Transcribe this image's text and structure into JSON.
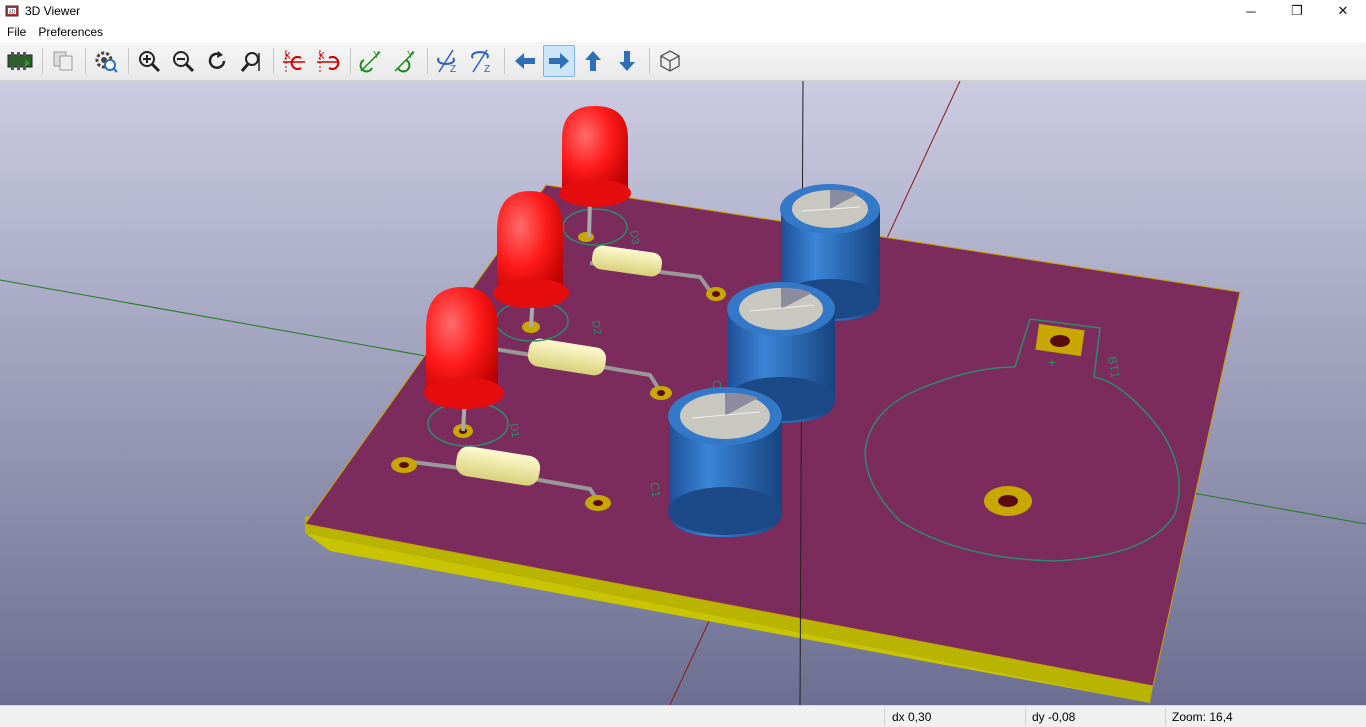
{
  "window": {
    "title": "3D Viewer",
    "controls": {
      "minimize": "─",
      "restore": "❐",
      "close": "✕"
    }
  },
  "menu": [
    {
      "label": "File"
    },
    {
      "label": "Preferences"
    }
  ],
  "toolbar": {
    "buttons": [
      {
        "name": "reload-board-button",
        "icon": "reload-board-icon"
      },
      {
        "name": "copy-to-clipboard-button",
        "icon": "copy-icon"
      },
      {
        "name": "settings-button",
        "icon": "settings-icon"
      },
      {
        "name": "zoom-in-button",
        "icon": "zoom-in-icon"
      },
      {
        "name": "zoom-out-button",
        "icon": "zoom-out-icon"
      },
      {
        "name": "redraw-button",
        "icon": "redraw-icon"
      },
      {
        "name": "zoom-fit-button",
        "icon": "zoom-fit-icon"
      },
      {
        "name": "rotate-x-cw-button",
        "icon": "rotate-x-icon"
      },
      {
        "name": "rotate-x-ccw-button",
        "icon": "rotate-x-icon"
      },
      {
        "name": "rotate-y-cw-button",
        "icon": "rotate-y-icon"
      },
      {
        "name": "rotate-y-ccw-button",
        "icon": "rotate-y-icon"
      },
      {
        "name": "rotate-z-cw-button",
        "icon": "rotate-z-icon"
      },
      {
        "name": "rotate-z-ccw-button",
        "icon": "rotate-z-icon"
      },
      {
        "name": "move-left-button",
        "icon": "arrow-left-icon"
      },
      {
        "name": "move-right-button",
        "icon": "arrow-right-icon",
        "active": true
      },
      {
        "name": "move-up-button",
        "icon": "arrow-up-icon"
      },
      {
        "name": "move-down-button",
        "icon": "arrow-down-icon"
      },
      {
        "name": "ortho-view-button",
        "icon": "cube-icon"
      }
    ],
    "axis_letters": {
      "x": "X",
      "y": "Y",
      "z": "Z"
    }
  },
  "scene": {
    "colors": {
      "background_top": "#c9c9e0",
      "background_bottom": "#6d7092",
      "pcb_top": "#7b2b5c",
      "pcb_edge": "#c3c000",
      "silkscreen": "#2e8a6e",
      "led": "#ff1a1a",
      "capacitor": "#2a6fbf",
      "resistor": "#f5f0a0",
      "pad": "#c8a800"
    },
    "labels": {
      "d1": "D1",
      "d2": "D2",
      "d3": "D3",
      "c1": "C1",
      "c2": "C2",
      "bt1": "BT1",
      "plus": "+"
    }
  },
  "status": {
    "dx": "dx 0,30",
    "dy": "dy -0,08",
    "zoom": "Zoom: 16,4"
  }
}
